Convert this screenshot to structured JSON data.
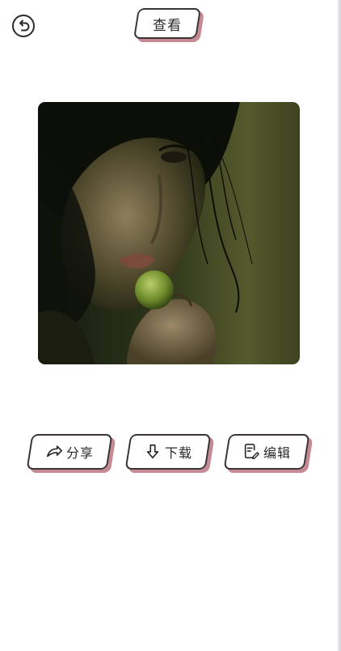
{
  "header": {
    "back_icon": "undo-arrow-icon",
    "view_label": "查看"
  },
  "photo": {
    "description_icon": "portrait-photo"
  },
  "actions": {
    "share": {
      "label": "分享",
      "icon": "share-arrow-icon"
    },
    "download": {
      "label": "下载",
      "icon": "download-arrow-icon"
    },
    "edit": {
      "label": "编辑",
      "icon": "edit-document-icon"
    }
  },
  "colors": {
    "button_border": "#3a3436",
    "button_shadow": "#c58a94",
    "background": "#ffffff"
  }
}
